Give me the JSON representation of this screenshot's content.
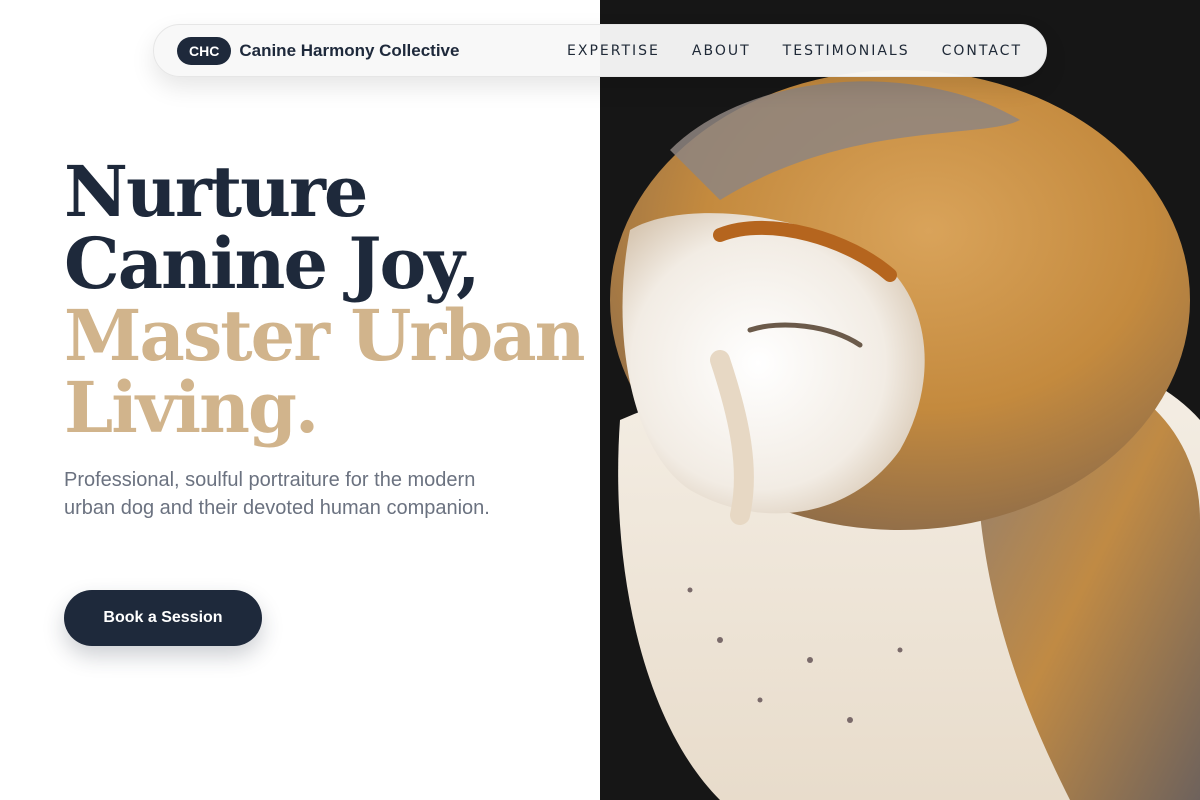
{
  "brand": {
    "badge": "CHC",
    "name": "Canine Harmony Collective"
  },
  "nav": {
    "items": [
      {
        "label": "EXPERTISE"
      },
      {
        "label": "ABOUT"
      },
      {
        "label": "TESTIMONIALS"
      },
      {
        "label": "CONTACT"
      }
    ]
  },
  "hero": {
    "headline_line1": "Nurture",
    "headline_line2": "Canine Joy,",
    "headline_line3": "Master Urban",
    "headline_line4": "Living.",
    "subtitle": "Professional, soulful portraiture for the modern urban dog and their devoted human companion.",
    "cta_label": "Book a Session",
    "image_subject": "barn-owl-photo"
  },
  "colors": {
    "primary_dark": "#1e293b",
    "accent_gold": "#d1b48c",
    "text_muted": "#6b7280",
    "image_background": "#161616"
  }
}
